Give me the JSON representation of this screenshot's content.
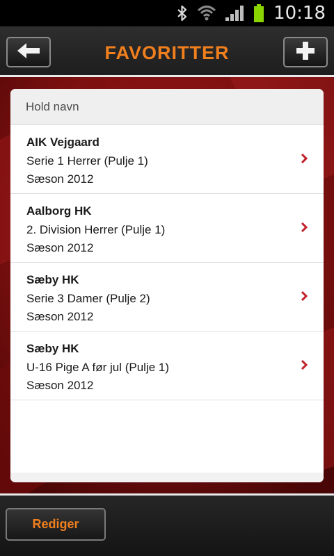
{
  "status_bar": {
    "time": "10:18",
    "icons": [
      "bluetooth-icon",
      "wifi-icon",
      "signal-icon",
      "battery-icon"
    ]
  },
  "header": {
    "title": "FAVORITTER",
    "back_icon": "arrow-left-icon",
    "add_icon": "plus-icon",
    "title_color": "#f07f1d"
  },
  "list": {
    "header": "Hold navn",
    "items": [
      {
        "team": "AIK Vejgaard",
        "league": "Serie 1 Herrer (Pulje 1)",
        "season": "Sæson 2012"
      },
      {
        "team": "Aalborg HK",
        "league": "2. Division Herrer (Pulje 1)",
        "season": "Sæson 2012"
      },
      {
        "team": "Sæby HK",
        "league": "Serie 3 Damer (Pulje 2)",
        "season": "Sæson 2012"
      },
      {
        "team": "Sæby HK",
        "league": "U-16 Pige A før jul (Pulje 1)",
        "season": "Sæson 2012"
      }
    ],
    "chevron_color": "#c0202a"
  },
  "footer": {
    "edit_label": "Rediger"
  }
}
